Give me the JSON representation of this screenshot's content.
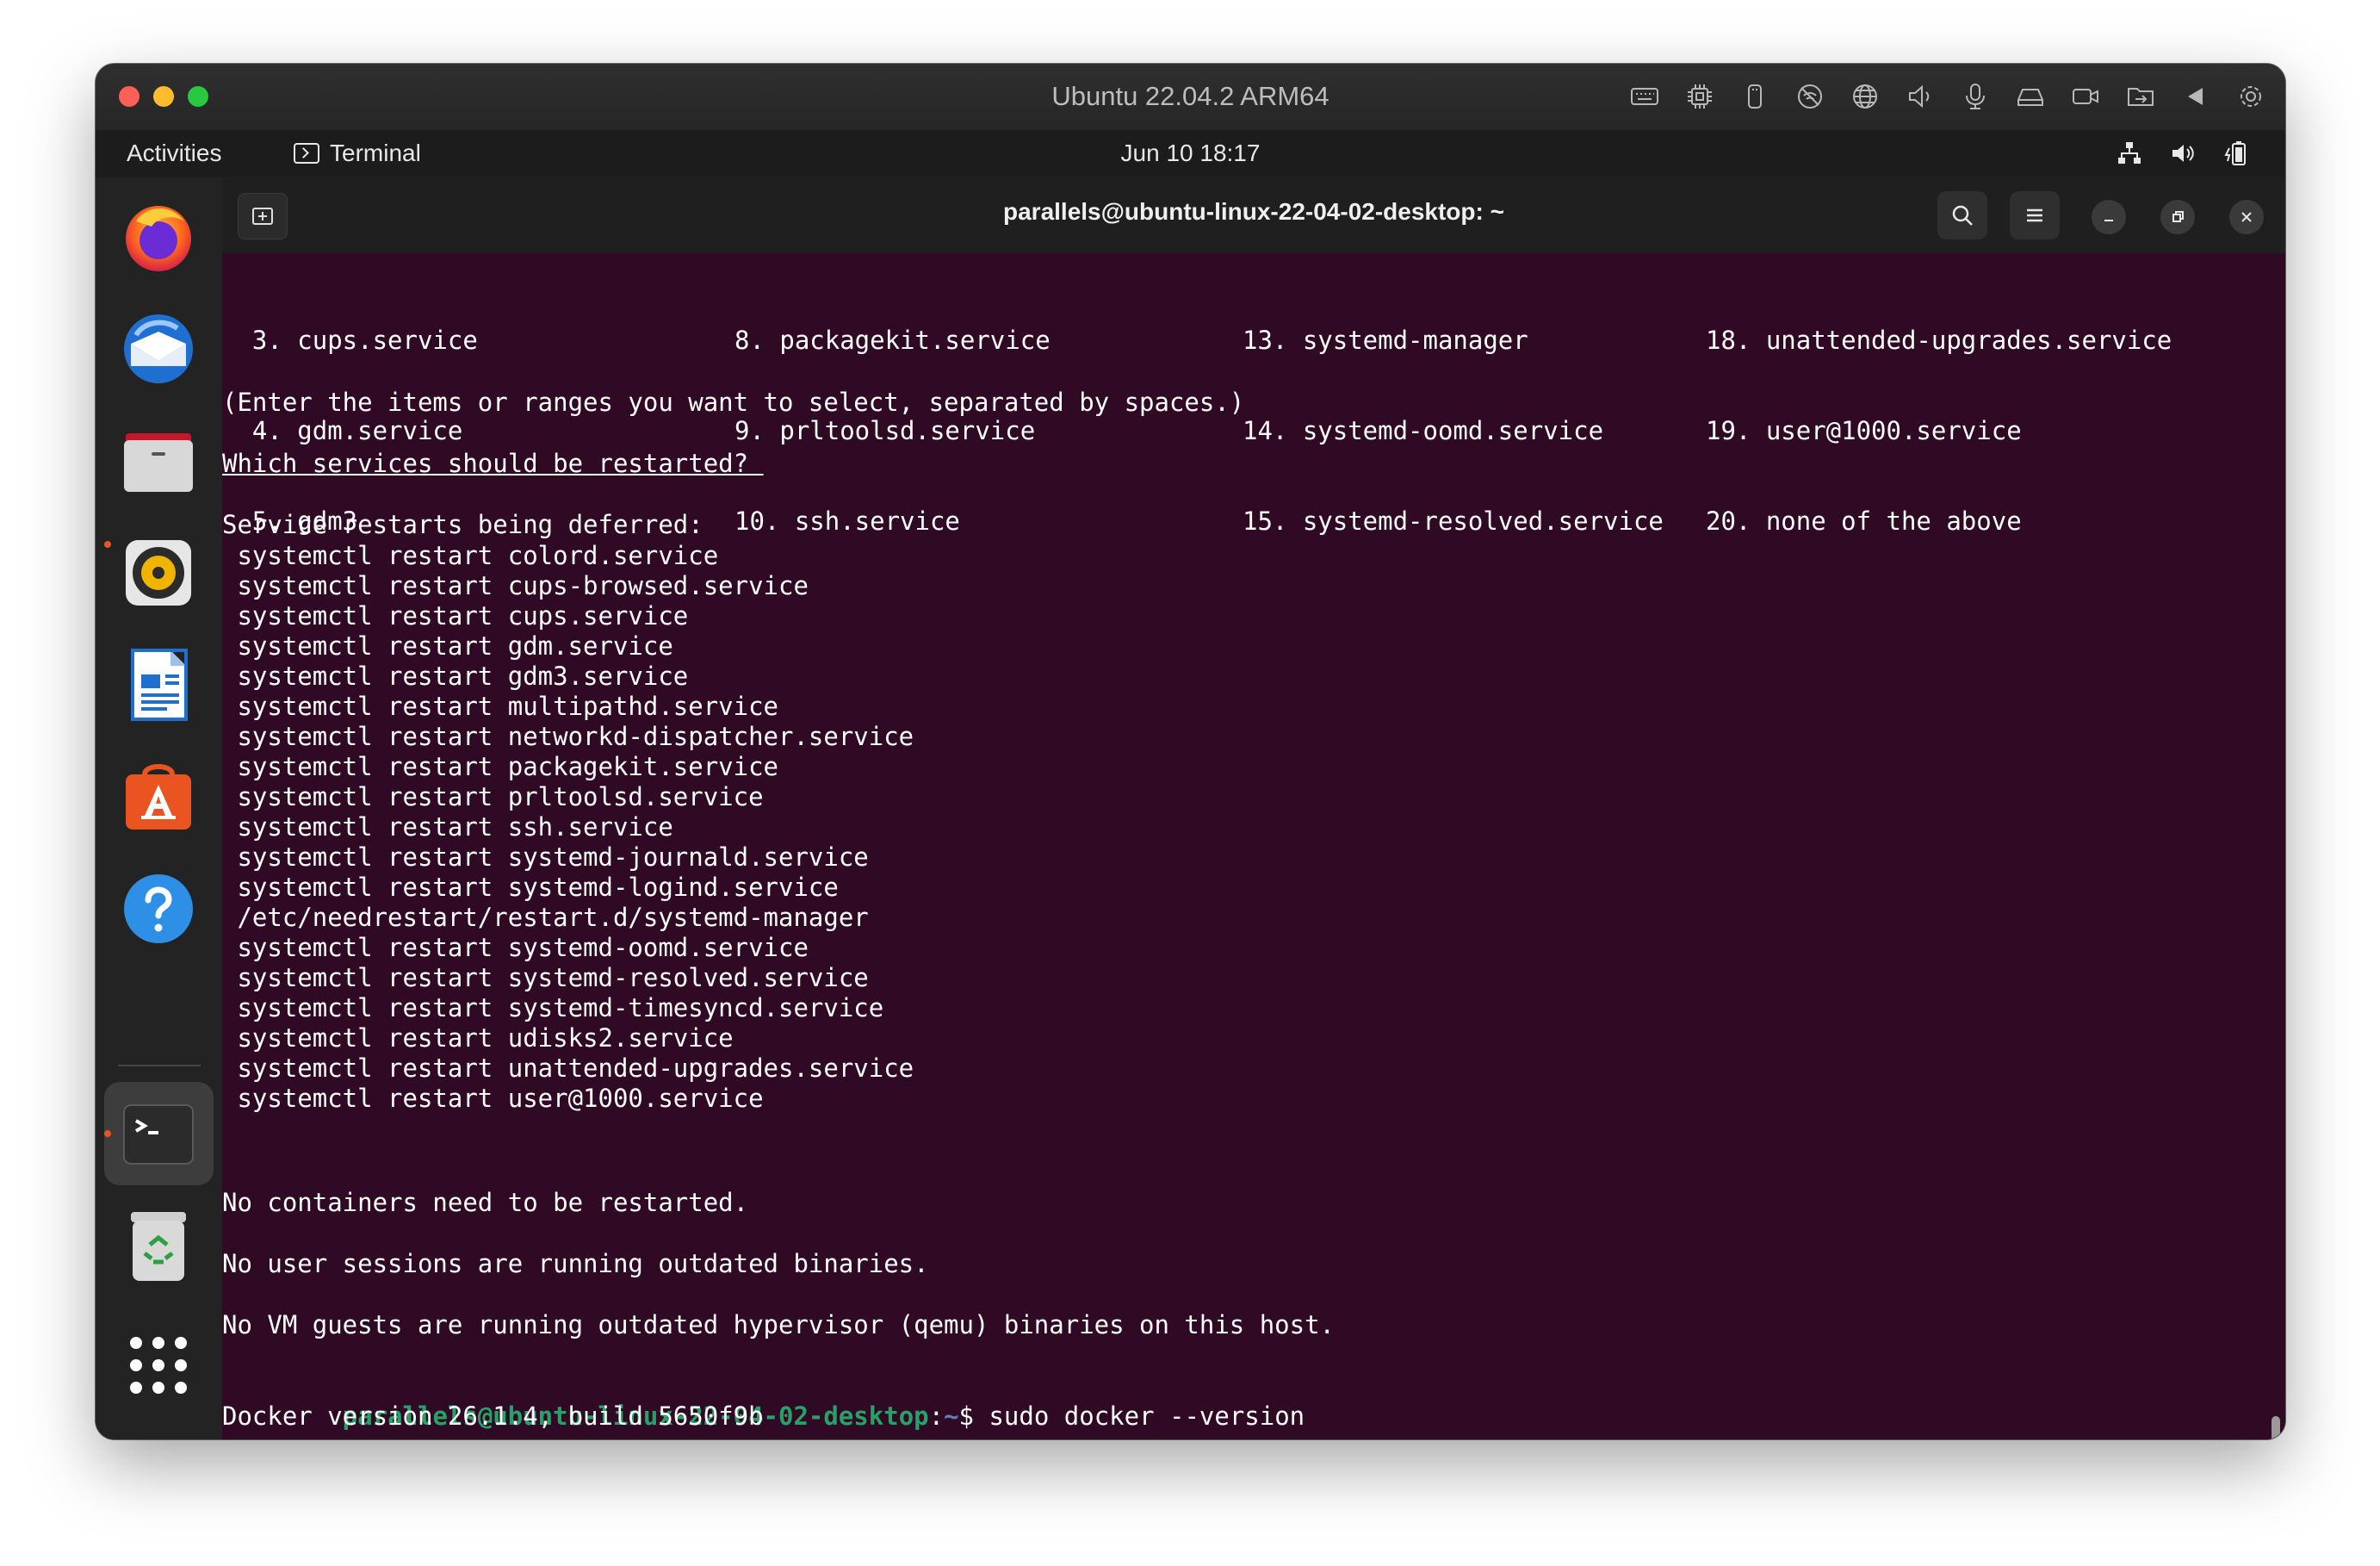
{
  "vm": {
    "title": "Ubuntu 22.04.2 ARM64",
    "tools": [
      "keyboard-icon",
      "cpu-icon",
      "usb-icon",
      "no-network-icon",
      "globe-icon",
      "speaker-icon",
      "microphone-icon",
      "drive-icon",
      "camera-icon",
      "shared-folder-icon",
      "back-icon",
      "gear-icon"
    ]
  },
  "topbar": {
    "activities": "Activities",
    "app_name": "Terminal",
    "clock": "Jun 10  18:17"
  },
  "dock": {
    "apps": [
      "firefox-icon",
      "thunderbird-icon",
      "files-icon",
      "rhythmbox-icon",
      "writer-icon",
      "software-icon",
      "help-icon",
      "terminal-icon",
      "trash-icon",
      "app-grid-icon"
    ]
  },
  "terminal": {
    "title": "parallels@ubuntu-linux-22-04-02-desktop: ~",
    "columns": [
      [
        "  3. cups.service",
        "  4. gdm.service",
        "  5. gdm3"
      ],
      [
        "8. packagekit.service",
        "9. prltoolsd.service",
        "10. ssh.service"
      ],
      [
        "13. systemd-manager",
        "14. systemd-oomd.service",
        "15. systemd-resolved.service"
      ],
      [
        "18. unattended-upgrades.service",
        "19. user@1000.service",
        "20. none of the above"
      ]
    ],
    "enter_hint": "(Enter the items or ranges you want to select, separated by spaces.)",
    "question": "Which services should be restarted? ",
    "deferred_header": "Service restarts being deferred:",
    "deferred": [
      " systemctl restart colord.service",
      " systemctl restart cups-browsed.service",
      " systemctl restart cups.service",
      " systemctl restart gdm.service",
      " systemctl restart gdm3.service",
      " systemctl restart multipathd.service",
      " systemctl restart networkd-dispatcher.service",
      " systemctl restart packagekit.service",
      " systemctl restart prltoolsd.service",
      " systemctl restart ssh.service",
      " systemctl restart systemd-journald.service",
      " systemctl restart systemd-logind.service",
      " /etc/needrestart/restart.d/systemd-manager",
      " systemctl restart systemd-oomd.service",
      " systemctl restart systemd-resolved.service",
      " systemctl restart systemd-timesyncd.service",
      " systemctl restart udisks2.service",
      " systemctl restart unattended-upgrades.service",
      " systemctl restart user@1000.service"
    ],
    "no_containers": "No containers need to be restarted.",
    "no_sessions": "No user sessions are running outdated binaries.",
    "no_vm": "No VM guests are running outdated hypervisor (qemu) binaries on this host.",
    "prompt_user": "parallels@ubuntu-linux-22-04-02-desktop",
    "prompt_sep": ":",
    "prompt_dir": "~",
    "prompt_char": "$",
    "command": " sudo docker --version",
    "docker_output": "Docker version 26.1.4, build 5650f9b"
  },
  "colors": {
    "terminal_bg": "#300a24",
    "prompt_green": "#26a269",
    "accent": "#e95420"
  }
}
